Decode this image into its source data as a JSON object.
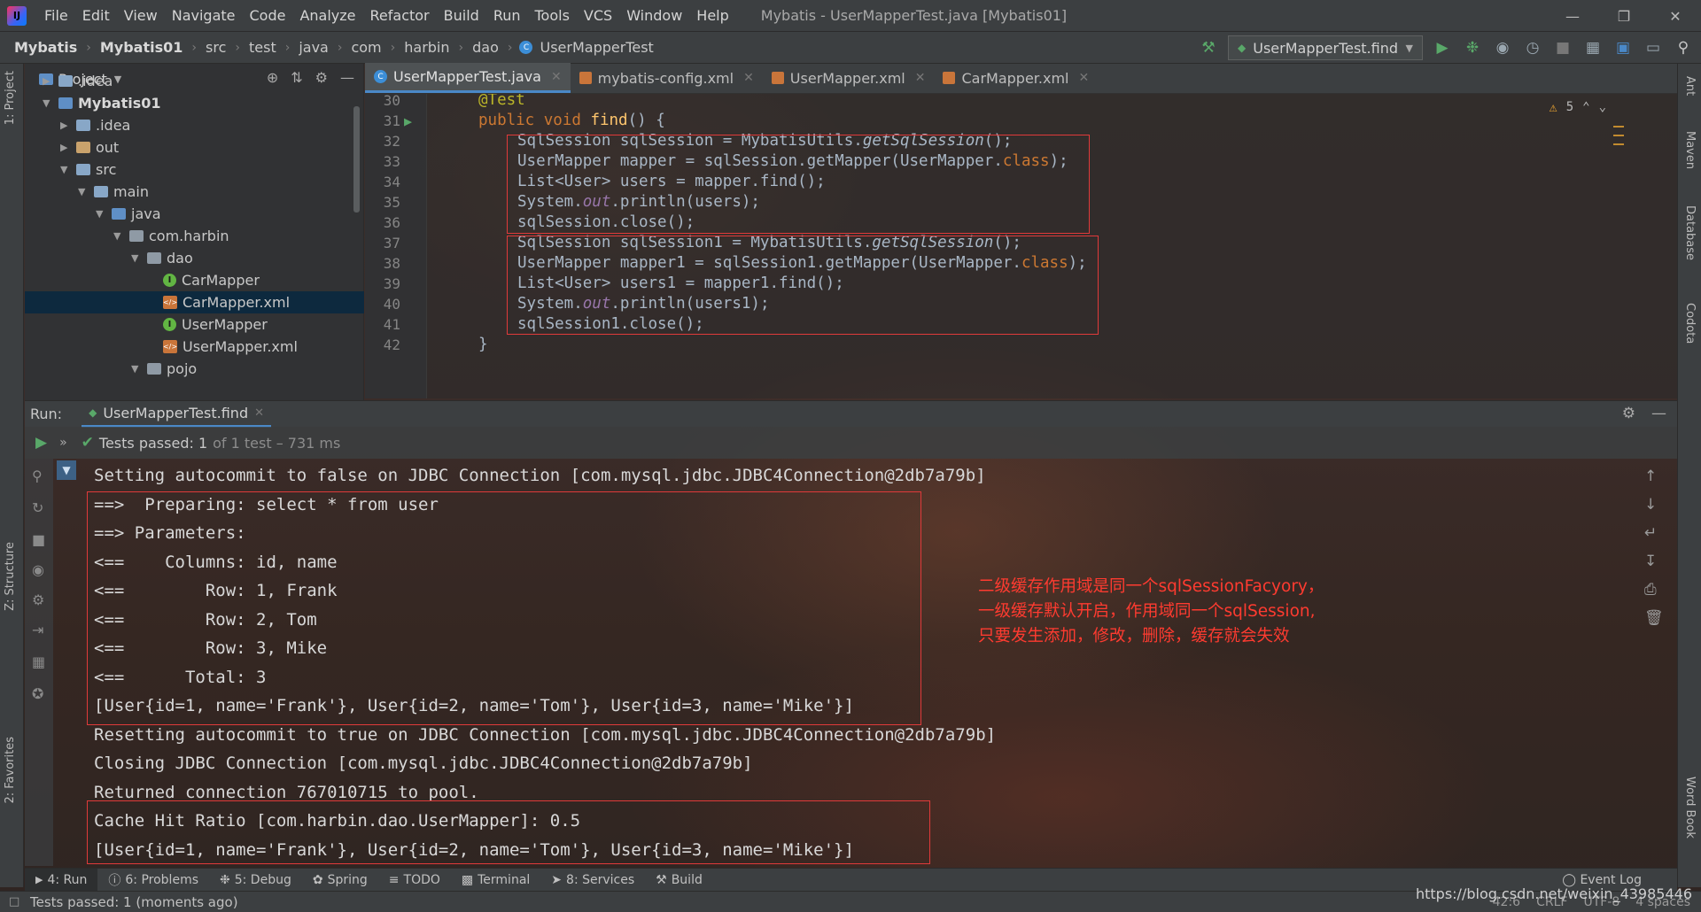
{
  "menubar": {
    "items": [
      "File",
      "Edit",
      "View",
      "Navigate",
      "Code",
      "Analyze",
      "Refactor",
      "Build",
      "Run",
      "Tools",
      "VCS",
      "Window",
      "Help"
    ],
    "title": "Mybatis - UserMapperTest.java [Mybatis01]"
  },
  "navbar": {
    "crumbs": [
      "Mybatis",
      "Mybatis01",
      "src",
      "test",
      "java",
      "com",
      "harbin",
      "dao",
      "UserMapperTest"
    ],
    "run_config": "UserMapperTest.find"
  },
  "left_strip": {
    "project_tab": "1: Project",
    "structure_tab": "Z: Structure",
    "favorites_tab": "2: Favorites"
  },
  "right_strip": {
    "ant": "Ant",
    "maven": "Maven",
    "database": "Database",
    "codota": "Codota",
    "word_book": "Word Book"
  },
  "project": {
    "title": "Project",
    "tree": [
      {
        "label": ".idea",
        "type": "folder"
      },
      {
        "label": "Mybatis01",
        "type": "module"
      },
      {
        "label": ".idea",
        "type": "folder"
      },
      {
        "label": "out",
        "type": "folder"
      },
      {
        "label": "src",
        "type": "folder"
      },
      {
        "label": "main",
        "type": "folder"
      },
      {
        "label": "java",
        "type": "folder"
      },
      {
        "label": "com.harbin",
        "type": "package"
      },
      {
        "label": "dao",
        "type": "package"
      },
      {
        "label": "CarMapper",
        "type": "interface"
      },
      {
        "label": "CarMapper.xml",
        "type": "xml"
      },
      {
        "label": "UserMapper",
        "type": "interface"
      },
      {
        "label": "UserMapper.xml",
        "type": "xml"
      },
      {
        "label": "pojo",
        "type": "package"
      }
    ]
  },
  "editor": {
    "tabs": [
      "UserMapperTest.java",
      "mybatis-config.xml",
      "UserMapper.xml",
      "CarMapper.xml"
    ],
    "warnings": "5",
    "line_numbers": [
      "30",
      "31",
      "32",
      "33",
      "34",
      "35",
      "36",
      "37",
      "38",
      "39",
      "40",
      "41",
      "42"
    ],
    "code": {
      "l30": "@Test",
      "l31_a": "public void ",
      "l31_b": "find",
      "l31_c": "() {",
      "l32_a": "SqlSession sqlSession = MybatisUtils.",
      "l32_b": "getSqlSession",
      "l32_c": "();",
      "l33_a": "UserMapper mapper = sqlSession.getMapper(UserMapper.",
      "l33_b": "class",
      "l33_c": ");",
      "l34": "List<User> users = mapper.find();",
      "l35_a": "System.",
      "l35_b": "out",
      "l35_c": ".println(users);",
      "l36": "sqlSession.close();",
      "l37_a": "SqlSession sqlSession1 = MybatisUtils.",
      "l37_b": "getSqlSession",
      "l37_c": "();",
      "l38_a": "UserMapper mapper1 = sqlSession1.getMapper(UserMapper.",
      "l38_b": "class",
      "l38_c": ");",
      "l39": "List<User> users1 = mapper1.find();",
      "l40_a": "System.",
      "l40_b": "out",
      "l40_c": ".println(users1);",
      "l41": "sqlSession1.close();",
      "l42": "}"
    }
  },
  "run": {
    "label": "Run:",
    "tab": "UserMapperTest.find",
    "tests_passed": "Tests passed: 1",
    "tests_sub": "of 1 test – 731 ms"
  },
  "console": {
    "lines": [
      "Setting autocommit to false on JDBC Connection [com.mysql.jdbc.JDBC4Connection@2db7a79b]",
      "==>  Preparing: select * from user",
      "==> Parameters: ",
      "<==    Columns: id, name",
      "<==        Row: 1, Frank",
      "<==        Row: 2, Tom",
      "<==        Row: 3, Mike",
      "<==      Total: 3",
      "[User{id=1, name='Frank'}, User{id=2, name='Tom'}, User{id=3, name='Mike'}]",
      "Resetting autocommit to true on JDBC Connection [com.mysql.jdbc.JDBC4Connection@2db7a79b]",
      "Closing JDBC Connection [com.mysql.jdbc.JDBC4Connection@2db7a79b]",
      "Returned connection 767010715 to pool.",
      "Cache Hit Ratio [com.harbin.dao.UserMapper]: 0.5",
      "[User{id=1, name='Frank'}, User{id=2, name='Tom'}, User{id=3, name='Mike'}]"
    ],
    "note": [
      "二级缓存作用域是同一个sqlSessionFacyory，",
      "一级缓存默认开启，作用域同一个sqlSession,",
      "只要发生添加，修改，删除，缓存就会失效"
    ]
  },
  "bottom_tools": {
    "run": "4: Run",
    "problems": "6: Problems",
    "debug": "5: Debug",
    "spring": "Spring",
    "todo": "TODO",
    "terminal": "Terminal",
    "services": "8: Services",
    "build": "Build",
    "event_log": "Event Log"
  },
  "status": {
    "text": "Tests passed: 1 (moments ago)",
    "position": "42:6",
    "line_sep": "CRLF",
    "encoding": "UTF-8",
    "indent": "4 spaces",
    "watermark": "https://blog.csdn.net/weixin_43985446"
  },
  "colors": {
    "accent": "#4a88c7",
    "highlight_box": "#e03a3a",
    "note_text": "#ff3b30",
    "pass": "#59a869"
  }
}
